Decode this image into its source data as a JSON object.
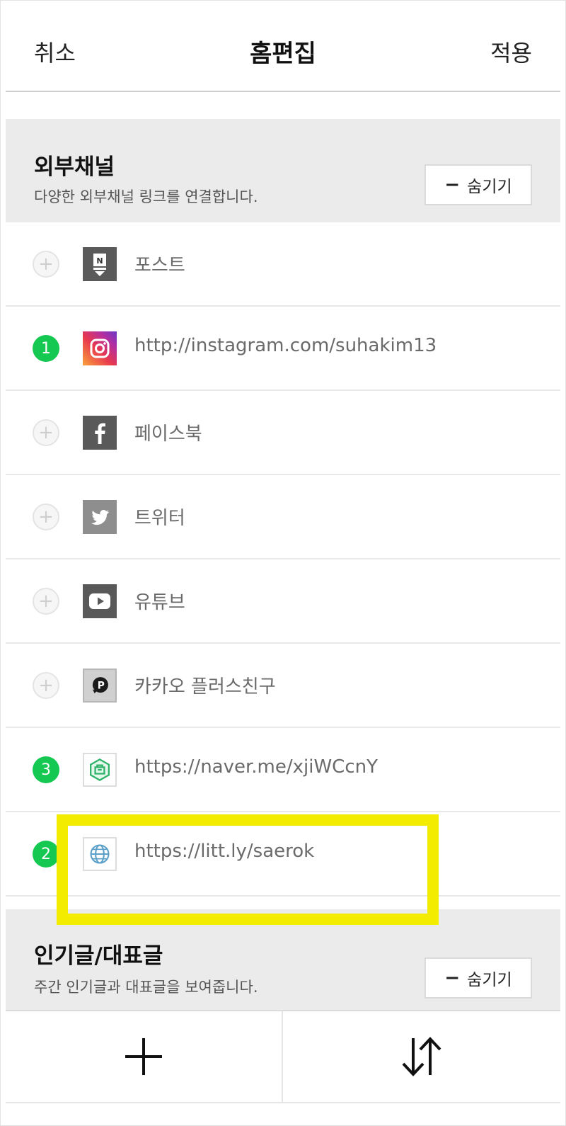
{
  "header": {
    "cancel_label": "취소",
    "title": "홈편집",
    "apply_label": "적용"
  },
  "external_section": {
    "title": "외부채널",
    "description": "다양한 외부채널 링크를 연결합니다.",
    "hide_label": "숨기기"
  },
  "channels": [
    {
      "label": "포스트",
      "status": "+",
      "icon": "naver-post-icon"
    },
    {
      "label": "http://instagram.com/suhakim13",
      "status": "1",
      "icon": "instagram-icon"
    },
    {
      "label": "페이스북",
      "status": "+",
      "icon": "facebook-icon"
    },
    {
      "label": "트위터",
      "status": "+",
      "icon": "twitter-icon"
    },
    {
      "label": "유튜브",
      "status": "+",
      "icon": "youtube-icon"
    },
    {
      "label": "카카오 플러스친구",
      "status": "+",
      "icon": "kakao-plus-icon"
    },
    {
      "label": "https://naver.me/xjiWCcnY",
      "status": "3",
      "icon": "naver-store-icon"
    },
    {
      "label": "https://litt.ly/saerok",
      "status": "2",
      "icon": "globe-icon"
    }
  ],
  "popular_section": {
    "title": "인기글/대표글",
    "description": "주간 인기글과 대표글을 보여줍니다.",
    "hide_label": "숨기기"
  },
  "bottom_bar": {
    "add_icon": "plus-icon",
    "reorder_icon": "sort-arrows-icon"
  },
  "colors": {
    "badge_green": "#14c851",
    "highlight_yellow": "#f3eb00",
    "section_gray": "#ebebeb"
  }
}
